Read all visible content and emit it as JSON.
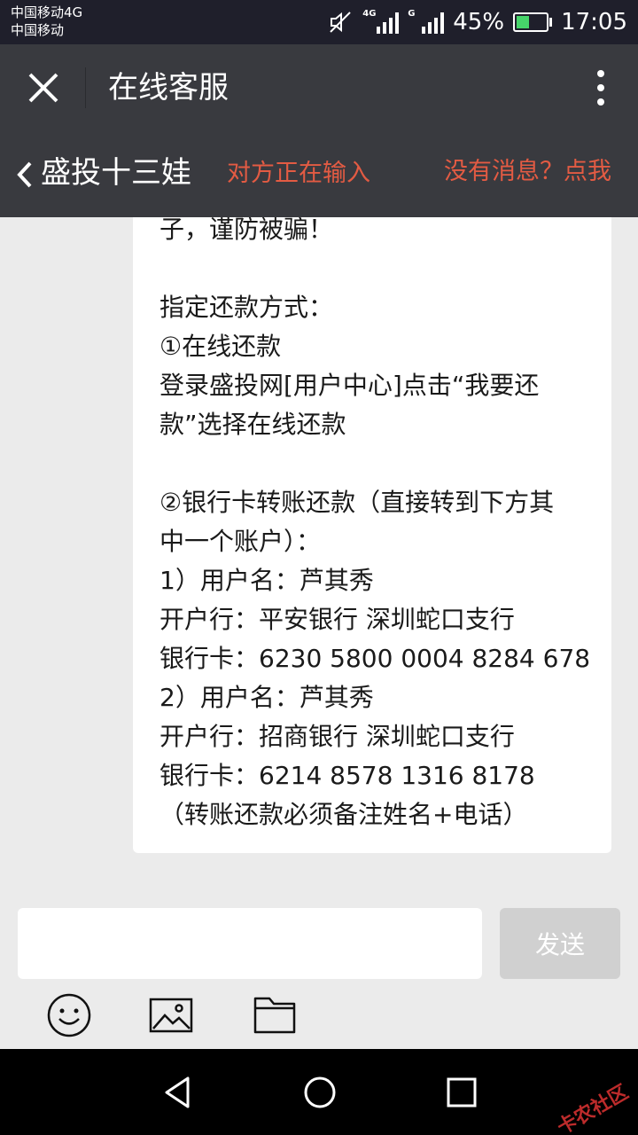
{
  "status_bar": {
    "carrier_1": "中国移动4G",
    "carrier_2": "中国移动",
    "network_1": "4G",
    "network_2": "G",
    "battery_percent": "45%",
    "battery_level": 0.45,
    "time": "17:05"
  },
  "title_bar": {
    "title": "在线客服",
    "close_icon": "close-icon",
    "more_icon": "more-vertical-icon"
  },
  "chat_header": {
    "contact_name": "盛投十三娃",
    "typing_status": "对方正在输入",
    "no_message_link": "没有消息？点我"
  },
  "message": {
    "lines": [
      "子，谨防被骗！",
      "",
      "指定还款方式：",
      "①在线还款",
      "登录盛投网[用户中心]点击“我要还",
      "款”选择在线还款",
      "",
      "②银行卡转账还款（直接转到下方其",
      "中一个账户）：",
      "1）用户名：芦其秀",
      "开户行：平安银行 深圳蛇口支行",
      "银行卡：6230 5800 0004 8284 678",
      "2）用户名：芦其秀",
      "开户行：招商银行 深圳蛇口支行",
      "银行卡：6214 8578 1316 8178",
      "（转账还款必须备注姓名+电话）"
    ]
  },
  "input": {
    "value": "",
    "placeholder": "",
    "send_label": "发送"
  },
  "toolbar": {
    "icons": [
      "emoji-icon",
      "image-icon",
      "folder-icon"
    ]
  },
  "nav_bar": {
    "icons": [
      "back-triangle-icon",
      "home-circle-icon",
      "recents-square-icon"
    ],
    "watermark": "卡农社区"
  },
  "colors": {
    "header_bg": "#393a3f",
    "status_bg": "#1f1f2b",
    "accent_red": "#e35b43",
    "chat_bg": "#ebebeb",
    "send_disabled": "#d0d0d0"
  }
}
